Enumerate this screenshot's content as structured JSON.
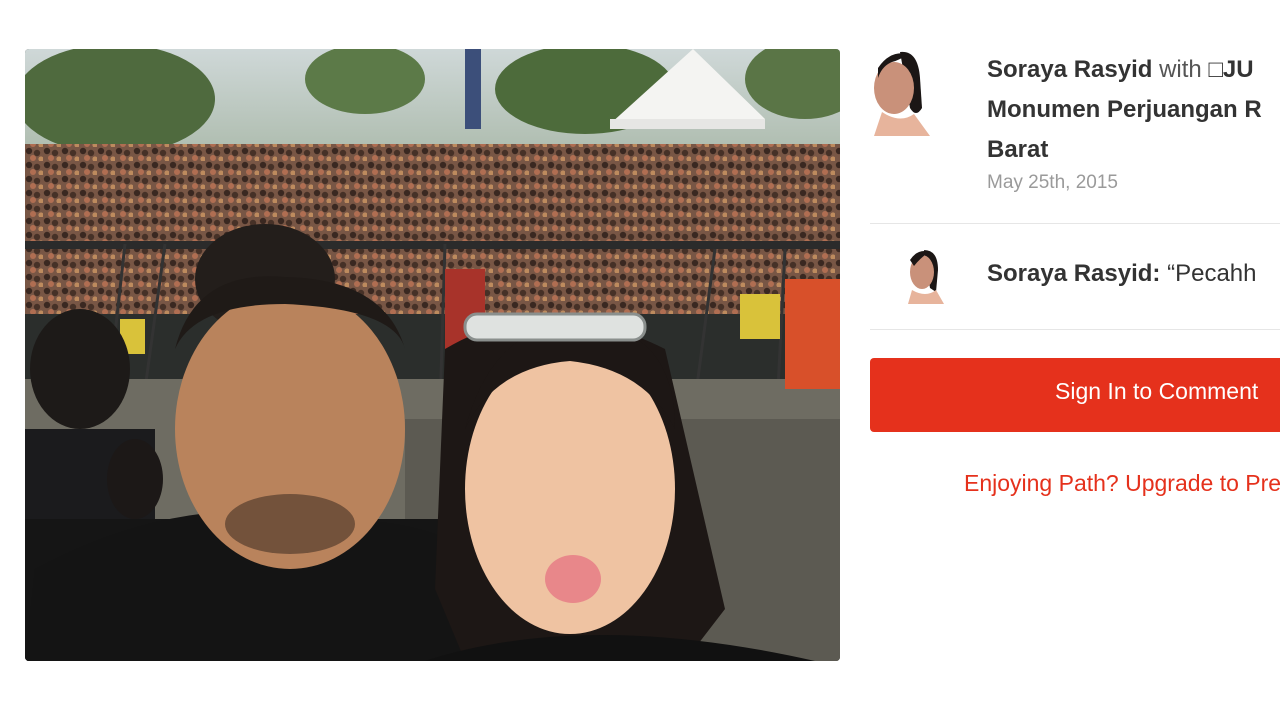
{
  "post": {
    "author": "Soraya Rasyid",
    "with_text": " with ",
    "with_name": "□JU",
    "location_line1": "Monumen Perjuangan R",
    "location_line2": "Barat",
    "date": "May 25th, 2015"
  },
  "comment": {
    "author": "Soraya Rasyid:",
    "text": " “Pecahh"
  },
  "actions": {
    "signin_label": "Sign In to Comment",
    "upgrade_label": "Enjoying Path? Upgrade to Pre"
  },
  "colors": {
    "accent": "#e5311c",
    "text": "#333333",
    "muted": "#9a9a9a"
  }
}
